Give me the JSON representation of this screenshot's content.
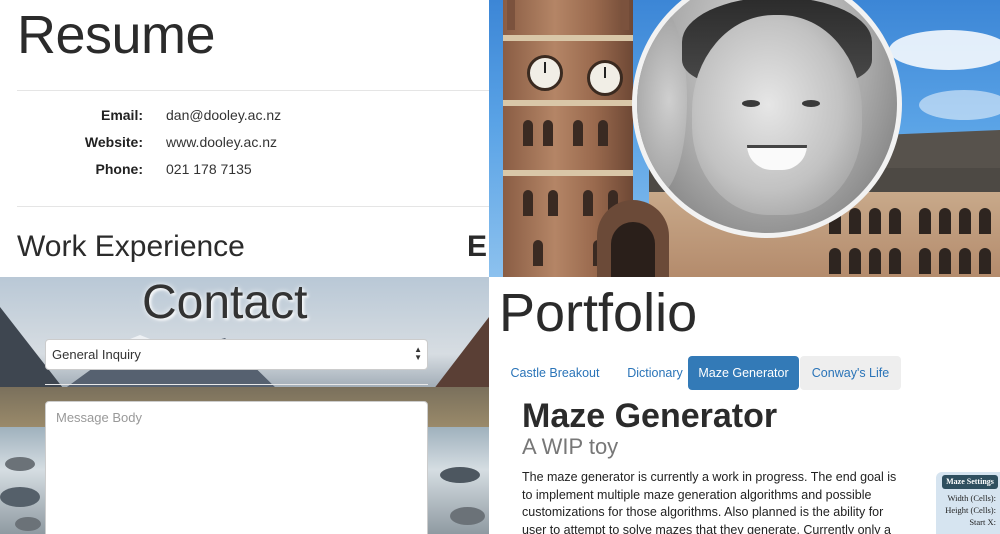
{
  "resume": {
    "title": "Resume",
    "fields": [
      {
        "label": "Email:",
        "value": "dan@dooley.ac.nz"
      },
      {
        "label": "Website:",
        "value": "www.dooley.ac.nz"
      },
      {
        "label": "Phone:",
        "value": "021 178 7135"
      }
    ],
    "work_heading": "Work Experience",
    "next_heading_fragment": "E"
  },
  "contact": {
    "title": "Contact",
    "inquiry_select": {
      "value": "General Inquiry"
    },
    "message": {
      "placeholder": "Message Body"
    }
  },
  "portfolio": {
    "title": "Portfolio",
    "tabs": [
      {
        "label": "Castle Breakout",
        "active": false
      },
      {
        "label": "Dictionary",
        "active": false
      },
      {
        "label": "Maze Generator",
        "active": true
      },
      {
        "label": "Conway's Life",
        "active": false
      }
    ],
    "project_title": "Maze Generator",
    "project_subtitle": "A WIP toy",
    "project_text": "The maze generator is currently a work in progress. The end goal is to implement multiple maze generation algorithms and possible customizations for those algorithms. Also planned is the ability for user to attempt to solve mazes that they generate. Currently only a single",
    "settings_panel": {
      "heading": "Maze Settings",
      "rows": [
        "Width (Cells):",
        "Height (Cells):",
        "Start X:"
      ]
    }
  },
  "colors": {
    "accent": "#337ab7",
    "tab_link": "#2a74b8"
  }
}
